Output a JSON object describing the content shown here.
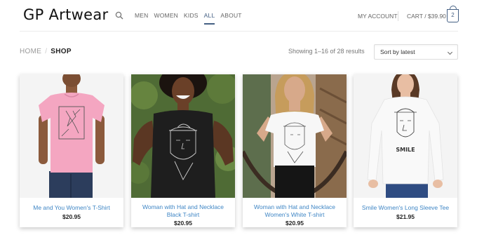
{
  "header": {
    "logo": "GP Artwear",
    "nav": [
      "MEN",
      "WOMEN",
      "KIDS",
      "ALL",
      "ABOUT"
    ],
    "active_nav": "ALL",
    "account": "MY ACCOUNT",
    "cart_label": "CART / $39.90",
    "cart_count": "2"
  },
  "breadcrumb": {
    "home": "HOME",
    "separator": "/",
    "current": "SHOP"
  },
  "results_text": "Showing 1–16 of 28 results",
  "sort": {
    "selected": "Sort by latest"
  },
  "products": [
    {
      "name": "Me and You Women's T-Shirt",
      "price": "$20.95"
    },
    {
      "name": "Woman with Hat and Necklace Black T-shirt",
      "price": "$20.95"
    },
    {
      "name": "Woman with Hat and Necklace Women's White T-shirt",
      "price": "$20.95"
    },
    {
      "name": "Smile Women's Long Sleeve Tee",
      "price": "$21.95"
    }
  ],
  "shirt_print_text": "SMILE",
  "colors": {
    "accent": "#446084",
    "link": "#3f86c5",
    "pink_shirt": "#f4a6c1",
    "black_shirt": "#1e1e1e"
  }
}
